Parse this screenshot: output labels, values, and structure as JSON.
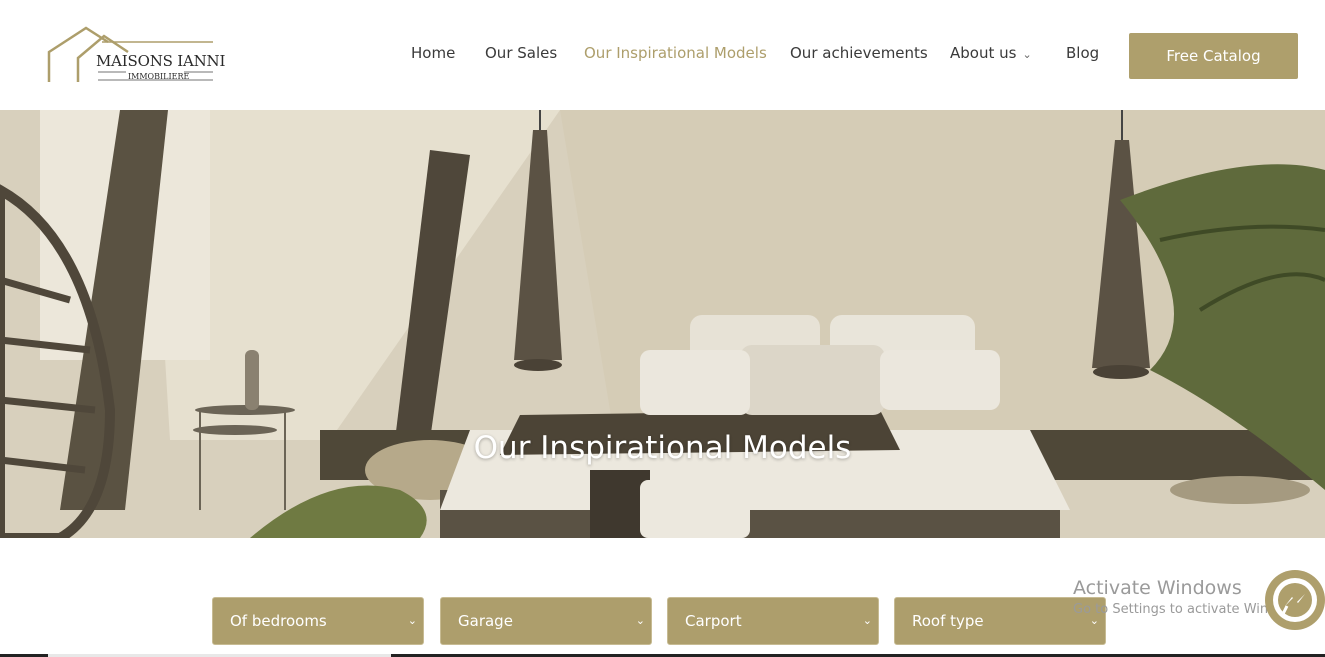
{
  "brand": {
    "name": "MAISONS IANNI",
    "tagline": "IMMOBILIERE",
    "color": "#ad9e6b"
  },
  "nav": {
    "items": [
      {
        "label": "Home",
        "active": false
      },
      {
        "label": "Our Sales",
        "active": false
      },
      {
        "label": "Our Inspirational Models",
        "active": true
      },
      {
        "label": "Our achievements",
        "active": false
      },
      {
        "label": "About us",
        "active": false,
        "has_dropdown": true
      },
      {
        "label": "Blog",
        "active": false
      }
    ],
    "cta_label": "Free Catalog"
  },
  "hero": {
    "title": "Our Inspirational Models"
  },
  "filters": [
    {
      "value": "Of bedrooms"
    },
    {
      "value": "Garage"
    },
    {
      "value": "Carport"
    },
    {
      "value": "Roof type"
    }
  ],
  "watermark": {
    "title": "Activate Windows",
    "subtitle": "Go to Settings to activate Windows."
  },
  "icons": {
    "dropdown": "chevron-down-icon",
    "chat": "messenger-icon"
  },
  "colors": {
    "accent": "#ae9f6c",
    "text": "#3a3a3a",
    "white": "#ffffff"
  }
}
